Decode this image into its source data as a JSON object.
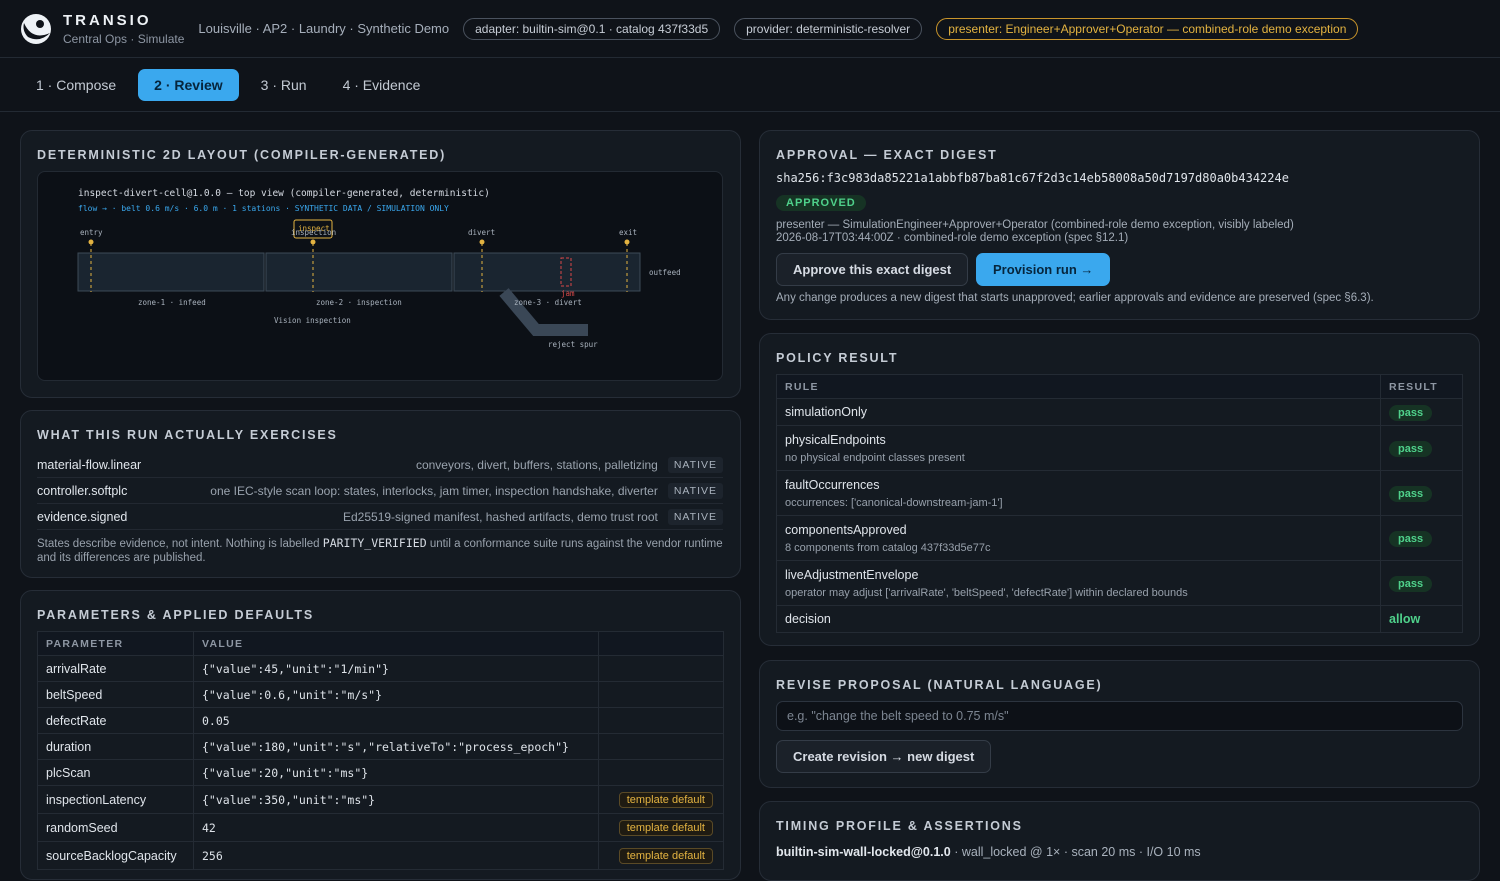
{
  "header": {
    "brand": "TRANSIO",
    "subtitle": "Central Ops · Simulate",
    "location": "Louisville · AP2 · Laundry · Synthetic Demo",
    "chips": {
      "adapter": "adapter: builtin-sim@0.1 · catalog 437f33d5",
      "provider": "provider: deterministic-resolver",
      "presenter": "presenter: Engineer+Approver+Operator — combined-role demo exception"
    }
  },
  "tabs": [
    "1 · Compose",
    "2 · Review",
    "3 · Run",
    "4 · Evidence"
  ],
  "layout": {
    "title": "DETERMINISTIC 2D LAYOUT (COMPILER-GENERATED)",
    "diagram_title": "inspect-divert-cell@1.0.0 — top view (compiler-generated, deterministic)",
    "diagram_subtitle": "flow → · belt 0.6 m/s · 6.0 m · 1 stations · SYNTHETIC DATA / SIMULATION ONLY",
    "labels": {
      "entry": "entry",
      "inspect": "inspect",
      "inspection": "inspection",
      "divert": "divert",
      "exit": "exit",
      "outfeed": "outfeed",
      "zone1": "zone-1 · infeed",
      "zone2": "zone-2 · inspection",
      "zone3": "zone-3 · divert",
      "jam": "jam",
      "vision": "Vision inspection",
      "reject": "reject spur"
    }
  },
  "exercises": {
    "title": "WHAT THIS RUN ACTUALLY EXERCISES",
    "rows": [
      {
        "name": "material-flow.linear",
        "desc": "conveyors, divert, buffers, stations, palletizing",
        "tag": "NATIVE"
      },
      {
        "name": "controller.softplc",
        "desc": "one IEC-style scan loop: states, interlocks, jam timer, inspection handshake, diverter",
        "tag": "NATIVE"
      },
      {
        "name": "evidence.signed",
        "desc": "Ed25519-signed manifest, hashed artifacts, demo trust root",
        "tag": "NATIVE"
      }
    ],
    "note_before": "States describe evidence, not intent. Nothing is labelled ",
    "note_code": "PARITY_VERIFIED",
    "note_after": " until a conformance suite runs against the vendor runtime and its differences are published."
  },
  "params": {
    "title": "PARAMETERS & APPLIED DEFAULTS",
    "headers": [
      "PARAMETER",
      "VALUE",
      ""
    ],
    "rows": [
      {
        "name": "arrivalRate",
        "value": "{\"value\":45,\"unit\":\"1/min\"}",
        "tag": ""
      },
      {
        "name": "beltSpeed",
        "value": "{\"value\":0.6,\"unit\":\"m/s\"}",
        "tag": ""
      },
      {
        "name": "defectRate",
        "value": "0.05",
        "tag": ""
      },
      {
        "name": "duration",
        "value": "{\"value\":180,\"unit\":\"s\",\"relativeTo\":\"process_epoch\"}",
        "tag": ""
      },
      {
        "name": "plcScan",
        "value": "{\"value\":20,\"unit\":\"ms\"}",
        "tag": ""
      },
      {
        "name": "inspectionLatency",
        "value": "{\"value\":350,\"unit\":\"ms\"}",
        "tag": "template default"
      },
      {
        "name": "randomSeed",
        "value": "42",
        "tag": "template default"
      },
      {
        "name": "sourceBacklogCapacity",
        "value": "256",
        "tag": "template default"
      }
    ]
  },
  "approval": {
    "title": "APPROVAL — EXACT DIGEST",
    "digest": "sha256:f3c983da85221a1abbfb87ba81c67f2d3c14eb58008a50d7197d80a0b434224e",
    "status": "APPROVED",
    "presenter": "presenter — SimulationEngineer+Approver+Operator (combined-role demo exception, visibly labeled)",
    "timestamp": "2026-08-17T03:44:00Z · combined-role demo exception (spec §12.1)",
    "approve_label": "Approve this exact digest",
    "provision_label": "Provision run →",
    "note": "Any change produces a new digest that starts unapproved; earlier approvals and evidence are preserved (spec §6.3)."
  },
  "policy": {
    "title": "POLICY RESULT",
    "headers": [
      "RULE",
      "RESULT"
    ],
    "rows": [
      {
        "rule": "simulationOnly",
        "desc": "",
        "result": "pass"
      },
      {
        "rule": "physicalEndpoints",
        "desc": "no physical endpoint classes present",
        "result": "pass"
      },
      {
        "rule": "faultOccurrences",
        "desc": "occurrences: ['canonical-downstream-jam-1']",
        "result": "pass"
      },
      {
        "rule": "componentsApproved",
        "desc": "8 components from catalog 437f33d5e77c",
        "result": "pass"
      },
      {
        "rule": "liveAdjustmentEnvelope",
        "desc": "operator may adjust ['arrivalRate', 'beltSpeed', 'defectRate'] within declared bounds",
        "result": "pass"
      }
    ],
    "decision_label": "decision",
    "decision_value": "allow"
  },
  "revise": {
    "title": "REVISE PROPOSAL (NATURAL LANGUAGE)",
    "placeholder": "e.g. \"change the belt speed to 0.75 m/s\"",
    "button": "Create revision → new digest"
  },
  "timing": {
    "title": "TIMING PROFILE & ASSERTIONS",
    "profile": "builtin-sim-wall-locked@0.1.0",
    "detail": " · wall_locked @ 1× · scan 20 ms · I/O 10 ms"
  },
  "colors": {
    "accent": "#3aa8ee",
    "pass": "#4fd18b",
    "warn": "#e3b341",
    "jam": "#d94848"
  }
}
